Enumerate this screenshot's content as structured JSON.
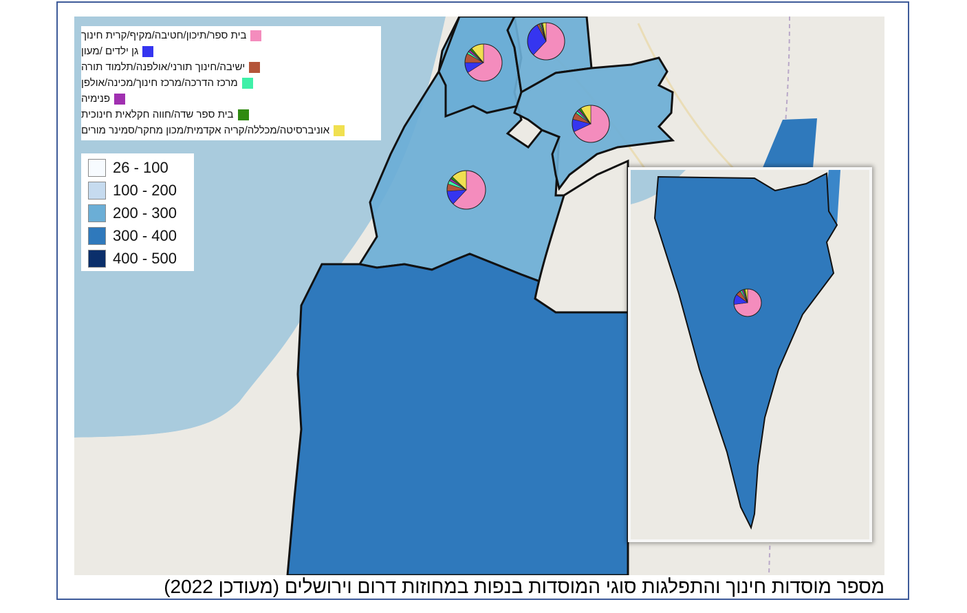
{
  "title": "מספר מוסדות חינוך והתפלגות סוגי המוסדות בנפות במחוזות דרום וירושלים (מעודכן 2022)",
  "colors": {
    "sea": "#a9cbdd",
    "land": "#eceae4",
    "border": "#111111",
    "frame": "#3d5a99"
  },
  "type_legend": [
    {
      "label": "בית ספר/תיכון/חטיבה/מקיף/קרית חינוך",
      "color": "#f48cbd"
    },
    {
      "label": "גן ילדים /מעון",
      "color": "#3535f0"
    },
    {
      "label": "ישיבה/חינוך תורני/אולפנה/תלמוד תורה",
      "color": "#b4553a"
    },
    {
      "label": "מרכז הדרכה/מרכז חינוך/מכינה/אולפן",
      "color": "#3ff0a8"
    },
    {
      "label": "פנימיה",
      "color": "#a030b0"
    },
    {
      "label": "בית ספר שדה/חווה חקלאית חינוכית",
      "color": "#2f8a10"
    },
    {
      "label": "אוניברסיטה/מכללה/קריה אקדמית/מכון מחקר/סמינר מורים",
      "color": "#f0e050"
    }
  ],
  "class_legend": [
    {
      "label": "26 - 100",
      "color": "#f7fbff"
    },
    {
      "label": "100 - 200",
      "color": "#c6dbef"
    },
    {
      "label": "200 - 300",
      "color": "#6baed6"
    },
    {
      "label": "300 - 400",
      "color": "#2f79bc"
    },
    {
      "label": "400 - 500",
      "color": "#0b2f6b"
    }
  ],
  "districts": [
    {
      "class": "200 - 300",
      "pie": [
        0.62,
        0.12,
        0.06,
        0.03,
        0.02,
        0.02,
        0.13
      ]
    },
    {
      "class": "200 - 300",
      "pie": [
        0.62,
        0.3,
        0.02,
        0.01,
        0.01,
        0.01,
        0.03
      ]
    },
    {
      "class": "200 - 300",
      "pie": [
        0.66,
        0.09,
        0.08,
        0.02,
        0.02,
        0.02,
        0.11
      ]
    },
    {
      "class": "200 - 300",
      "pie": [
        0.68,
        0.11,
        0.06,
        0.02,
        0.02,
        0.02,
        0.09
      ]
    },
    {
      "class": "300 - 400",
      "pie": [
        0.73,
        0.12,
        0.06,
        0.02,
        0.02,
        0.02,
        0.03
      ]
    }
  ]
}
